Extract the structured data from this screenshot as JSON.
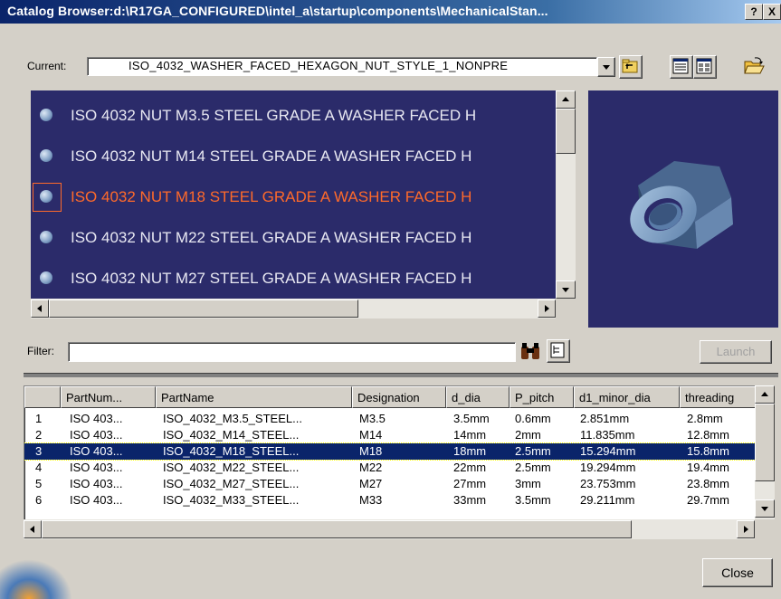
{
  "window": {
    "title": "Catalog Browser:d:\\R17GA_CONFIGURED\\intel_a\\startup\\components\\MechanicalStan...",
    "help_label": "?",
    "close_label": "X"
  },
  "current": {
    "label": "Current:",
    "value": "ISO_4032_WASHER_FACED_HEXAGON_NUT_STYLE_1_NONPRE"
  },
  "toolbar": {
    "icons": [
      "up-folder-icon",
      "list-view-icon",
      "detail-view-icon",
      "open-folder-icon"
    ]
  },
  "list": {
    "items": [
      {
        "label": "ISO 4032 NUT M3.5 STEEL GRADE A WASHER FACED H"
      },
      {
        "label": "ISO 4032 NUT M14 STEEL GRADE A WASHER FACED H"
      },
      {
        "label": "ISO 4032 NUT M18 STEEL GRADE A WASHER FACED H"
      },
      {
        "label": "ISO 4032 NUT M22 STEEL GRADE A WASHER FACED H"
      },
      {
        "label": "ISO 4032 NUT M27 STEEL GRADE A WASHER FACED H"
      }
    ],
    "selected_index": 2,
    "highlight_color": "#ff6a2a",
    "background_color": "#2b2b6a"
  },
  "preview": {
    "icon": "hex-nut-3d-icon"
  },
  "filter": {
    "label": "Filter:",
    "value": "",
    "launch_label": "Launch"
  },
  "table": {
    "headers": [
      "",
      "PartNum...",
      "PartName",
      "Designation",
      "d_dia",
      "P_pitch",
      "d1_minor_dia",
      "threading"
    ],
    "rows": [
      [
        "1",
        "ISO 403...",
        "ISO_4032_M3.5_STEEL...",
        "M3.5",
        "3.5mm",
        "0.6mm",
        "2.851mm",
        "2.8mm"
      ],
      [
        "2",
        "ISO 403...",
        "ISO_4032_M14_STEEL...",
        "M14",
        "14mm",
        "2mm",
        "11.835mm",
        "12.8mm"
      ],
      [
        "3",
        "ISO 403...",
        "ISO_4032_M18_STEEL...",
        "M18",
        "18mm",
        "2.5mm",
        "15.294mm",
        "15.8mm"
      ],
      [
        "4",
        "ISO 403...",
        "ISO_4032_M22_STEEL...",
        "M22",
        "22mm",
        "2.5mm",
        "19.294mm",
        "19.4mm"
      ],
      [
        "5",
        "ISO 403...",
        "ISO_4032_M27_STEEL...",
        "M27",
        "27mm",
        "3mm",
        "23.753mm",
        "23.8mm"
      ],
      [
        "6",
        "ISO 403...",
        "ISO_4032_M33_STEEL...",
        "M33",
        "33mm",
        "3.5mm",
        "29.211mm",
        "29.7mm"
      ]
    ],
    "selected_index": 2
  },
  "buttons": {
    "close_label": "Close"
  }
}
